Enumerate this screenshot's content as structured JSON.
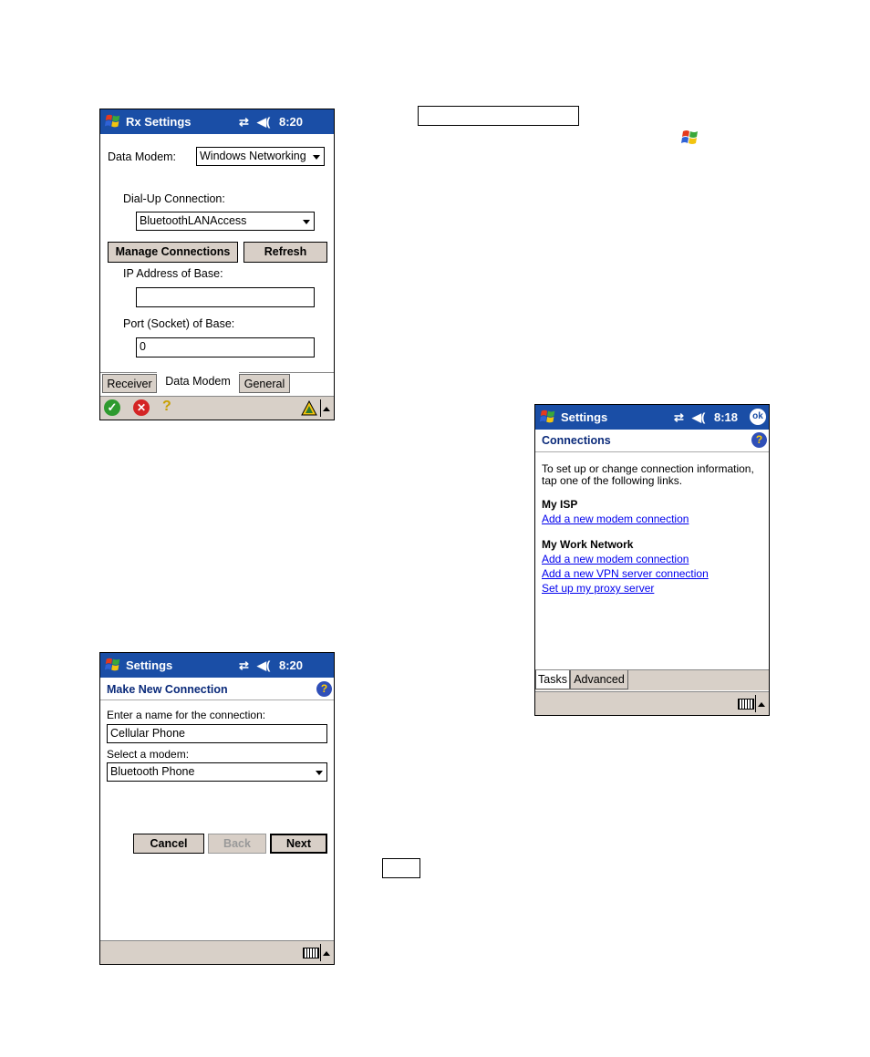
{
  "rx": {
    "title": "Rx Settings",
    "time": "8:20",
    "data_modem_label": "Data Modem:",
    "data_modem_value": "Windows Networking",
    "dialup_label": "Dial-Up Connection:",
    "dialup_value": "BluetoothLANAccess",
    "manage_btn": "Manage Connections",
    "refresh_btn": "Refresh",
    "ip_label": "IP Address of Base:",
    "ip_value": "",
    "port_label": "Port (Socket) of Base:",
    "port_value": "0",
    "tabs": [
      "Receiver",
      "Data Modem",
      "General"
    ]
  },
  "connections": {
    "title": "Settings",
    "time": "8:18",
    "ok": "ok",
    "header": "Connections",
    "intro_line1": "To set up or change connection information,",
    "intro_line2": "tap one of the following links.",
    "isp_heading": "My ISP",
    "isp_link": "Add a new modem connection",
    "work_heading": "My Work Network",
    "work_links": [
      "Add a new modem connection",
      "Add a new VPN server connection",
      "Set up my proxy server"
    ],
    "tabs": [
      "Tasks",
      "Advanced"
    ]
  },
  "newconn": {
    "title": "Settings",
    "time": "8:20",
    "header": "Make New Connection",
    "name_label": "Enter a name for the connection:",
    "name_value": "Cellular Phone",
    "modem_label": "Select a modem:",
    "modem_value": "Bluetooth Phone",
    "cancel": "Cancel",
    "back": "Back",
    "next": "Next"
  },
  "icons": {
    "start": "windows-flag-icon",
    "connectivity": "connectivity-icon",
    "speaker": "speaker-icon",
    "help": "help-icon",
    "keyboard": "keyboard-icon"
  },
  "colors": {
    "titlebar": "#1a4ea6",
    "link": "#0000ee",
    "button_face": "#d8cfc7"
  }
}
